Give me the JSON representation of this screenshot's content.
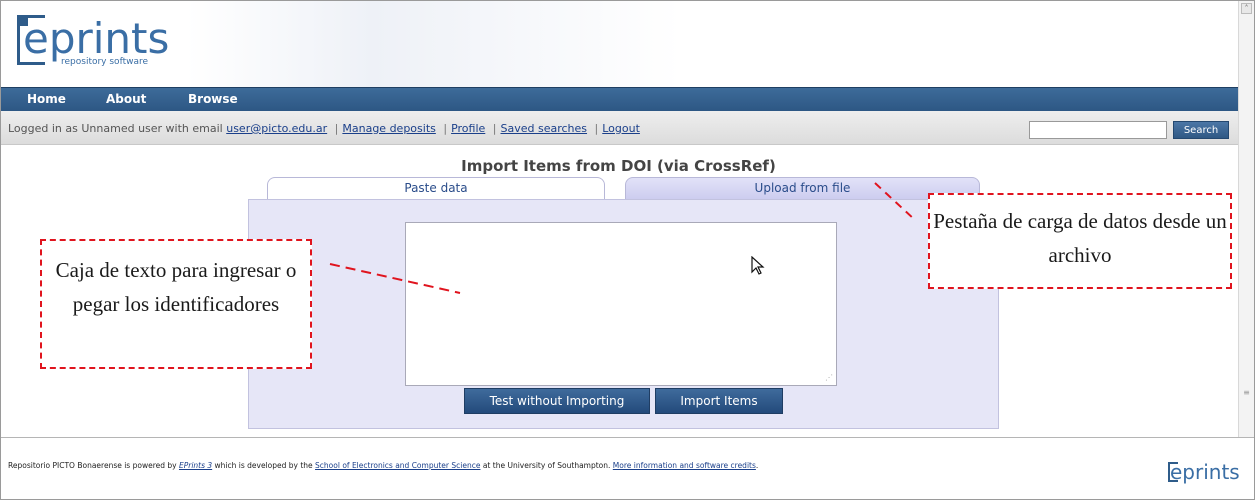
{
  "header": {
    "logo_text": "eprints",
    "logo_sub": "repository software"
  },
  "nav": {
    "items": [
      {
        "label": "Home"
      },
      {
        "label": "About"
      },
      {
        "label": "Browse"
      }
    ]
  },
  "login_bar": {
    "prefix": "Logged in as Unnamed user with email",
    "email": "user@picto.edu.ar",
    "links": [
      {
        "label": "Manage deposits"
      },
      {
        "label": "Profile"
      },
      {
        "label": "Saved searches"
      },
      {
        "label": "Logout"
      }
    ],
    "search_value": "",
    "search_button": "Search"
  },
  "page": {
    "title": "Import Items from DOI (via CrossRef)",
    "tabs": [
      {
        "label": "Paste data",
        "active": true
      },
      {
        "label": "Upload from file",
        "active": false
      }
    ],
    "textarea_value": "",
    "buttons": {
      "test": "Test without Importing",
      "import": "Import Items"
    }
  },
  "annotations": {
    "left_text": "Caja de texto para ingresar o pegar los identificadores",
    "right_text": "Pestaña de carga de datos desde un archivo"
  },
  "footer": {
    "t1": "Repositorio PICTO Bonaerense is powered by ",
    "link1": "EPrints 3",
    "t2": " which is developed by the ",
    "link2": "School of Electronics and Computer Science",
    "t3": " at the University of Southampton. ",
    "link3": "More information and software credits",
    "t4": ".",
    "logo_text": "eprints"
  },
  "colors": {
    "nav_bg": "#2d5784",
    "annotation_border": "#e0141e",
    "panel_bg": "#e6e6f7",
    "button_bg": "#2f5884"
  }
}
